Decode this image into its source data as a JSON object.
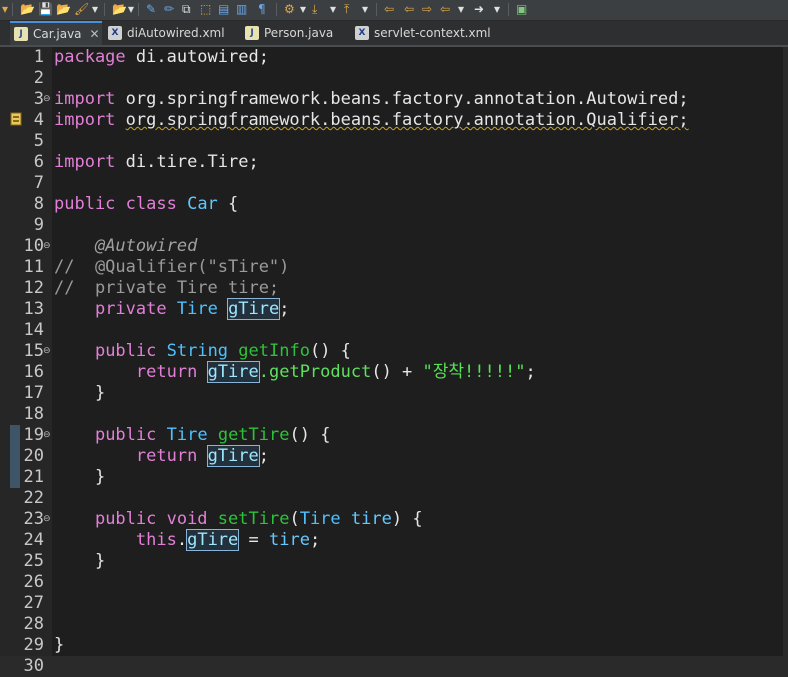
{
  "tabs": [
    {
      "label": "Car.java",
      "icon": "java-file-icon",
      "active": true
    },
    {
      "label": "diAutowired.xml",
      "icon": "xml-file-icon"
    },
    {
      "label": "Person.java",
      "icon": "java-file-icon"
    },
    {
      "label": "servlet-context.xml",
      "icon": "xml-file-icon"
    }
  ],
  "lines": {
    "n1": "1",
    "n2": "2",
    "n3": "3",
    "n4": "4",
    "n5": "5",
    "n6": "6",
    "n7": "7",
    "n8": "8",
    "n9": "9",
    "n10": "10",
    "n11": "11",
    "n12": "12",
    "n13": "13",
    "n14": "14",
    "n15": "15",
    "n16": "16",
    "n17": "17",
    "n18": "18",
    "n19": "19",
    "n20": "20",
    "n21": "21",
    "n22": "22",
    "n23": "23",
    "n24": "24",
    "n25": "25",
    "n26": "26",
    "n27": "27",
    "n28": "28",
    "n29": "29",
    "n30": "30"
  },
  "code": {
    "l1_kw": "package",
    "l1_rest": " di.autowired;",
    "l3_kw": "import",
    "l3_rest": " org.springframework.beans.factory.annotation.Autowired;",
    "l4_kw": "import",
    "l4_rest": "org.springframework.beans.factory.annotation.Qualifier;",
    "l6_kw": "import",
    "l6_rest": " di.tire.Tire;",
    "l8_kw": "public class",
    "l8_cls": "Car",
    "l8_rest": " {",
    "l10": "@Autowired",
    "l11": "//  @Qualifier(\"sTire\")",
    "l12": "//  private Tire tire;",
    "l13_kw": "private",
    "l13_ty": "Tire",
    "l13_fld": "gTire",
    "l13_end": ";",
    "l15_kw": "public",
    "l15_ty": "String",
    "l15_m": "getInfo",
    "l15_rest": "() {",
    "l16_kw": "return",
    "l16_fld": "gTire",
    "l16_m": ".getProduct",
    "l16_mid": "() + ",
    "l16_str": "\"장착!!!!!\"",
    "l16_end": ";",
    "l17": "}",
    "l19_kw": "public",
    "l19_ty": "Tire",
    "l19_m": "getTire",
    "l19_rest": "() {",
    "l20_kw": "return",
    "l20_fld": "gTire",
    "l20_end": ";",
    "l21": "}",
    "l23_kw": "public void",
    "l23_m": "setTire",
    "l23_p1": "(",
    "l23_ty": "Tire",
    "l23_par": "tire",
    "l23_rest": ") {",
    "l24_kw": "this",
    "l24_dot": ".",
    "l24_fld": "gTire",
    "l24_eq": " = ",
    "l24_par": "tire",
    "l24_end": ";",
    "l25": "}",
    "l29": "}"
  }
}
